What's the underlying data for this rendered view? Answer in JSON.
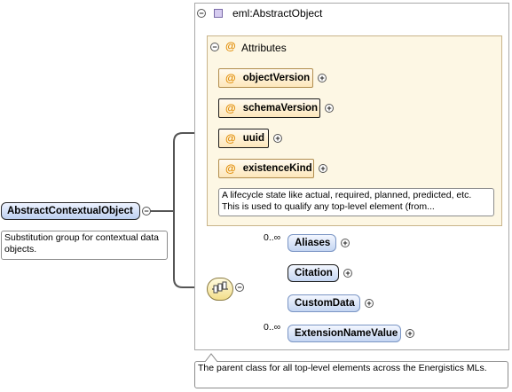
{
  "root": {
    "name": "AbstractContextualObject",
    "description": "Substitution group for contextual data objects."
  },
  "type": {
    "name": "eml:AbstractObject",
    "description": "The parent class for all top-level elements across the Energistics MLs."
  },
  "attributes": {
    "group_label": "Attributes",
    "at_symbol": "@",
    "items": [
      {
        "name": "objectVersion",
        "required": false
      },
      {
        "name": "schemaVersion",
        "required": true
      },
      {
        "name": "uuid",
        "required": true
      },
      {
        "name": "existenceKind",
        "required": false
      }
    ],
    "existence_note": "A lifecycle state like actual, required, planned, predicted, etc. This is used to qualify any top-level element (from..."
  },
  "sequence": {
    "children": [
      {
        "name": "Aliases",
        "multiplicity": "0..∞",
        "required": false
      },
      {
        "name": "Citation",
        "multiplicity": "",
        "required": true
      },
      {
        "name": "CustomData",
        "multiplicity": "",
        "required": false
      },
      {
        "name": "ExtensionNameValue",
        "multiplicity": "0..∞",
        "required": false
      }
    ]
  }
}
